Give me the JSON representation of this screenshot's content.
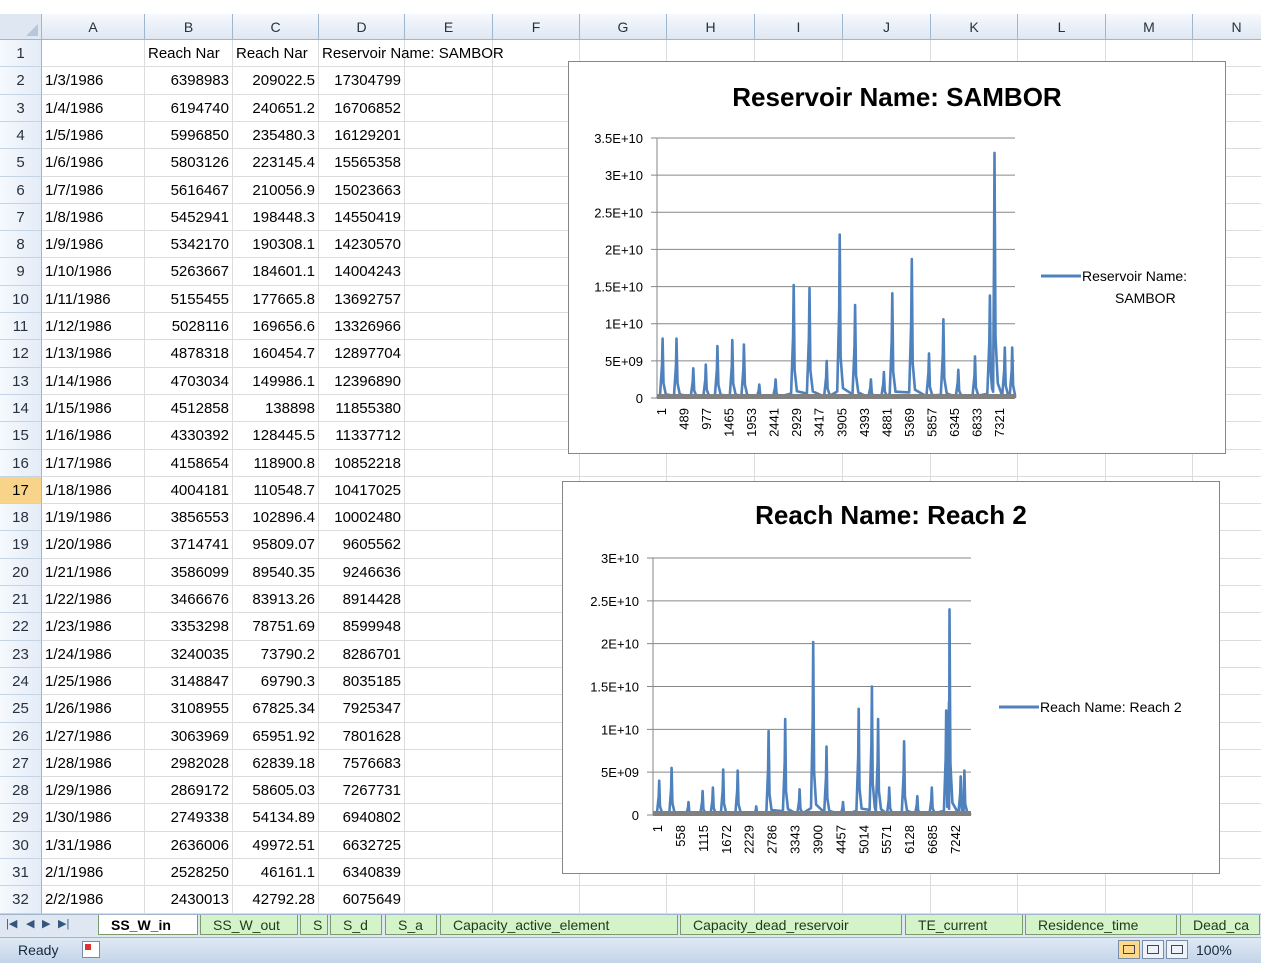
{
  "columns": [
    "A",
    "B",
    "C",
    "D",
    "E",
    "F",
    "G",
    "H",
    "I",
    "J",
    "K",
    "L",
    "M",
    "N"
  ],
  "selected_row": 17,
  "header_row": {
    "B": "Reach Nar",
    "C": "Reach Nar",
    "D": "Reservoir Name: SAMBOR"
  },
  "rows": [
    {
      "n": "1",
      "a": "",
      "b": "",
      "c": "",
      "d": ""
    },
    {
      "n": "2",
      "a": "1/3/1986",
      "b": "6398983",
      "c": "209022.5",
      "d": "17304799"
    },
    {
      "n": "3",
      "a": "1/4/1986",
      "b": "6194740",
      "c": "240651.2",
      "d": "16706852"
    },
    {
      "n": "4",
      "a": "1/5/1986",
      "b": "5996850",
      "c": "235480.3",
      "d": "16129201"
    },
    {
      "n": "5",
      "a": "1/6/1986",
      "b": "5803126",
      "c": "223145.4",
      "d": "15565358"
    },
    {
      "n": "6",
      "a": "1/7/1986",
      "b": "5616467",
      "c": "210056.9",
      "d": "15023663"
    },
    {
      "n": "7",
      "a": "1/8/1986",
      "b": "5452941",
      "c": "198448.3",
      "d": "14550419"
    },
    {
      "n": "8",
      "a": "1/9/1986",
      "b": "5342170",
      "c": "190308.1",
      "d": "14230570"
    },
    {
      "n": "9",
      "a": "1/10/1986",
      "b": "5263667",
      "c": "184601.1",
      "d": "14004243"
    },
    {
      "n": "10",
      "a": "1/11/1986",
      "b": "5155455",
      "c": "177665.8",
      "d": "13692757"
    },
    {
      "n": "11",
      "a": "1/12/1986",
      "b": "5028116",
      "c": "169656.6",
      "d": "13326966"
    },
    {
      "n": "12",
      "a": "1/13/1986",
      "b": "4878318",
      "c": "160454.7",
      "d": "12897704"
    },
    {
      "n": "13",
      "a": "1/14/1986",
      "b": "4703034",
      "c": "149986.1",
      "d": "12396890"
    },
    {
      "n": "14",
      "a": "1/15/1986",
      "b": "4512858",
      "c": "138898",
      "d": "11855380"
    },
    {
      "n": "15",
      "a": "1/16/1986",
      "b": "4330392",
      "c": "128445.5",
      "d": "11337712"
    },
    {
      "n": "16",
      "a": "1/17/1986",
      "b": "4158654",
      "c": "118900.8",
      "d": "10852218"
    },
    {
      "n": "17",
      "a": "1/18/1986",
      "b": "4004181",
      "c": "110548.7",
      "d": "10417025"
    },
    {
      "n": "18",
      "a": "1/19/1986",
      "b": "3856553",
      "c": "102896.4",
      "d": "10002480"
    },
    {
      "n": "19",
      "a": "1/20/1986",
      "b": "3714741",
      "c": "95809.07",
      "d": "9605562"
    },
    {
      "n": "20",
      "a": "1/21/1986",
      "b": "3586099",
      "c": "89540.35",
      "d": "9246636"
    },
    {
      "n": "21",
      "a": "1/22/1986",
      "b": "3466676",
      "c": "83913.26",
      "d": "8914428"
    },
    {
      "n": "22",
      "a": "1/23/1986",
      "b": "3353298",
      "c": "78751.69",
      "d": "8599948"
    },
    {
      "n": "23",
      "a": "1/24/1986",
      "b": "3240035",
      "c": "73790.2",
      "d": "8286701"
    },
    {
      "n": "24",
      "a": "1/25/1986",
      "b": "3148847",
      "c": "69790.3",
      "d": "8035185"
    },
    {
      "n": "25",
      "a": "1/26/1986",
      "b": "3108955",
      "c": "67825.34",
      "d": "7925347"
    },
    {
      "n": "26",
      "a": "1/27/1986",
      "b": "3063969",
      "c": "65951.92",
      "d": "7801628"
    },
    {
      "n": "27",
      "a": "1/28/1986",
      "b": "2982028",
      "c": "62839.18",
      "d": "7576683"
    },
    {
      "n": "28",
      "a": "1/29/1986",
      "b": "2869172",
      "c": "58605.03",
      "d": "7267731"
    },
    {
      "n": "29",
      "a": "1/30/1986",
      "b": "2749338",
      "c": "54134.89",
      "d": "6940802"
    },
    {
      "n": "30",
      "a": "1/31/1986",
      "b": "2636006",
      "c": "49972.51",
      "d": "6632725"
    },
    {
      "n": "31",
      "a": "2/1/1986",
      "b": "2528250",
      "c": "46161.1",
      "d": "6340839"
    },
    {
      "n": "32",
      "a": "2/2/1986",
      "b": "2430013",
      "c": "42792.28",
      "d": "6075649"
    }
  ],
  "chart_data": [
    {
      "type": "line",
      "title": "Reservoir Name: SAMBOR",
      "series": [
        {
          "name": "Reservoir Name: SAMBOR"
        }
      ],
      "ylim": [
        0,
        35000000000
      ],
      "y_ticks": [
        "0",
        "5E+09",
        "1E+10",
        "1.5E+10",
        "2E+10",
        "2.5E+10",
        "3E+10",
        "3.5E+10"
      ],
      "x_ticks": [
        "1",
        "489",
        "977",
        "1465",
        "1953",
        "2441",
        "2929",
        "3417",
        "3905",
        "4393",
        "4881",
        "5369",
        "5857",
        "6345",
        "6833",
        "7321"
      ],
      "peaks": [
        {
          "x": 120,
          "y": 8000000000
        },
        {
          "x": 420,
          "y": 8000000000
        },
        {
          "x": 780,
          "y": 4000000000
        },
        {
          "x": 1050,
          "y": 4500000000
        },
        {
          "x": 1300,
          "y": 7000000000
        },
        {
          "x": 1620,
          "y": 7800000000
        },
        {
          "x": 1870,
          "y": 7200000000
        },
        {
          "x": 2200,
          "y": 1800000000
        },
        {
          "x": 2550,
          "y": 2500000000
        },
        {
          "x": 2940,
          "y": 15200000000
        },
        {
          "x": 3280,
          "y": 14800000000
        },
        {
          "x": 3650,
          "y": 5000000000
        },
        {
          "x": 3930,
          "y": 22000000000
        },
        {
          "x": 4260,
          "y": 12500000000
        },
        {
          "x": 4600,
          "y": 2500000000
        },
        {
          "x": 4880,
          "y": 3500000000
        },
        {
          "x": 5060,
          "y": 14100000000
        },
        {
          "x": 5480,
          "y": 18700000000
        },
        {
          "x": 5850,
          "y": 6000000000
        },
        {
          "x": 6160,
          "y": 10600000000
        },
        {
          "x": 6480,
          "y": 3800000000
        },
        {
          "x": 6840,
          "y": 5600000000
        },
        {
          "x": 7160,
          "y": 13800000000
        },
        {
          "x": 7260,
          "y": 33000000000
        },
        {
          "x": 7480,
          "y": 6800000000
        },
        {
          "x": 7640,
          "y": 6800000000
        }
      ]
    },
    {
      "type": "line",
      "title": "Reach Name: Reach 2",
      "series": [
        {
          "name": "Reach Name:  Reach 2"
        }
      ],
      "ylim": [
        0,
        30000000000
      ],
      "y_ticks": [
        "0",
        "5E+09",
        "1E+10",
        "1.5E+10",
        "2E+10",
        "2.5E+10",
        "3E+10"
      ],
      "x_ticks": [
        "1",
        "558",
        "1115",
        "1672",
        "2229",
        "2786",
        "3343",
        "3900",
        "4457",
        "5014",
        "5571",
        "6128",
        "6685",
        "7242"
      ],
      "peaks": [
        {
          "x": 150,
          "y": 4000000000
        },
        {
          "x": 450,
          "y": 5500000000
        },
        {
          "x": 860,
          "y": 1500000000
        },
        {
          "x": 1200,
          "y": 2800000000
        },
        {
          "x": 1450,
          "y": 3200000000
        },
        {
          "x": 1700,
          "y": 5300000000
        },
        {
          "x": 2050,
          "y": 5200000000
        },
        {
          "x": 2500,
          "y": 1000000000
        },
        {
          "x": 2800,
          "y": 9800000000
        },
        {
          "x": 3200,
          "y": 11200000000
        },
        {
          "x": 3550,
          "y": 3000000000
        },
        {
          "x": 3880,
          "y": 20200000000
        },
        {
          "x": 4200,
          "y": 8000000000
        },
        {
          "x": 4600,
          "y": 1500000000
        },
        {
          "x": 4980,
          "y": 12400000000
        },
        {
          "x": 5300,
          "y": 15000000000
        },
        {
          "x": 5450,
          "y": 11200000000
        },
        {
          "x": 5720,
          "y": 3200000000
        },
        {
          "x": 6080,
          "y": 8600000000
        },
        {
          "x": 6400,
          "y": 2200000000
        },
        {
          "x": 6750,
          "y": 3200000000
        },
        {
          "x": 7100,
          "y": 12200000000
        },
        {
          "x": 7180,
          "y": 24000000000
        },
        {
          "x": 7450,
          "y": 4500000000
        },
        {
          "x": 7540,
          "y": 5200000000
        }
      ]
    }
  ],
  "sheet_tabs": [
    "SS_W_in",
    "SS_W_out",
    "S",
    "S_d",
    "S_a",
    "Capacity_active_element",
    "Capacity_dead_reservoir",
    "TE_current",
    "Residence_time",
    "Dead_ca"
  ],
  "active_tab": "SS_W_in",
  "status": {
    "ready": "Ready",
    "zoom": "100%"
  },
  "colors": {
    "series": "#4f81bd",
    "grid_header": "#dfe7f2",
    "tab": "#d4f3c8"
  }
}
